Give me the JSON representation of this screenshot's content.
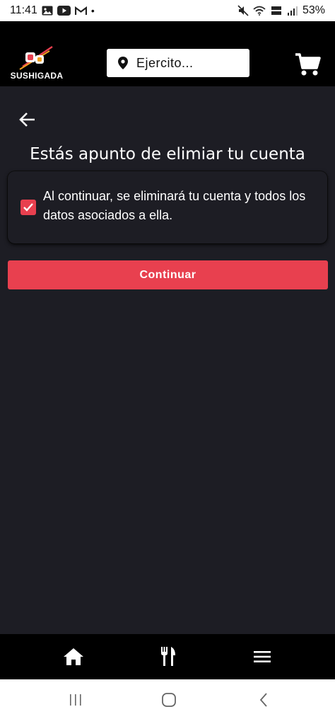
{
  "status_bar": {
    "time": "11:41",
    "dot": "•",
    "battery": "53%",
    "icons_left": [
      "gallery-icon",
      "youtube-icon",
      "gmail-icon"
    ],
    "icons_right": [
      "mute-icon",
      "wifi-icon",
      "volte-icon",
      "signal-icon"
    ]
  },
  "header": {
    "logo_text": "SUSHIGADA",
    "location_label": "Ejercito...",
    "location_icon": "map-pin-icon",
    "cart_icon": "cart-icon"
  },
  "main": {
    "back_icon": "arrow-left-icon",
    "title": "Estás apunto de elimiar tu cuenta",
    "checkbox_checked": true,
    "confirmation_text": "Al continuar, se eliminará tu cuenta y todos los datos asociados a ella.",
    "continue_label": "Continuar"
  },
  "bottom_nav": {
    "items": [
      "home-icon",
      "utensils-icon",
      "menu-icon"
    ]
  },
  "colors": {
    "accent": "#e8404f",
    "background": "#1d1d24",
    "header": "#000000"
  }
}
